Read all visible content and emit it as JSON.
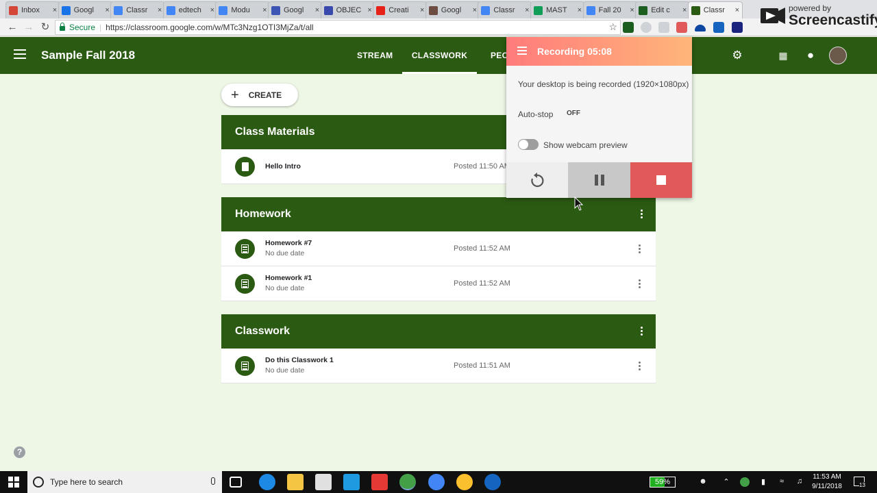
{
  "browser": {
    "tabs": [
      {
        "label": "Inbox",
        "color": "#d44638"
      },
      {
        "label": "Googl",
        "color": "#1a73e8"
      },
      {
        "label": "Classr",
        "color": "#4285f4"
      },
      {
        "label": "edtech",
        "color": "#4285f4"
      },
      {
        "label": "Modu",
        "color": "#4285f4"
      },
      {
        "label": "Googl",
        "color": "#3c55b4"
      },
      {
        "label": "OBJEC",
        "color": "#3949ab"
      },
      {
        "label": "Creati",
        "color": "#e62117"
      },
      {
        "label": "Googl",
        "color": "#6d4c41"
      },
      {
        "label": "Classr",
        "color": "#4285f4"
      },
      {
        "label": "MAST",
        "color": "#0f9d58"
      },
      {
        "label": "Fall 20",
        "color": "#4285f4"
      },
      {
        "label": "Edit c",
        "color": "#1b5e20"
      },
      {
        "label": "Classr",
        "color": "#2b5a12"
      }
    ],
    "secure_label": "Secure",
    "url": "https://classroom.google.com/w/MTc3Nzg1OTI3MjZa/t/all"
  },
  "header": {
    "class_title": "Sample Fall 2018",
    "nav": [
      "STREAM",
      "CLASSWORK",
      "PEO"
    ]
  },
  "create_label": "CREATE",
  "topics": [
    {
      "title": "Class Materials",
      "items": [
        {
          "title": "Hello Intro",
          "sub": "",
          "posted": "Posted 11:50 AM",
          "icon": "book-icon"
        }
      ]
    },
    {
      "title": "Homework",
      "items": [
        {
          "title": "Homework #7",
          "sub": "No due date",
          "posted": "Posted 11:52 AM",
          "icon": "assignment-icon"
        },
        {
          "title": "Homework #1",
          "sub": "No due date",
          "posted": "Posted 11:52 AM",
          "icon": "assignment-icon"
        }
      ]
    },
    {
      "title": "Classwork",
      "items": [
        {
          "title": "Do this Classwork 1",
          "sub": "No due date",
          "posted": "Posted 11:51 AM",
          "icon": "assignment-icon"
        }
      ]
    }
  ],
  "screencastify": {
    "title": "Recording 05:08",
    "desc": "Your desktop is being recorded (1920×1080px)",
    "autostop_label": "Auto-stop",
    "autostop_value": "OFF",
    "webcam_label": "Show webcam preview",
    "colors": {
      "restart": "#eeeeee",
      "pause": "#c8c8c8",
      "stop": "#e05a5a"
    }
  },
  "watermark": {
    "small": "powered by",
    "big": "Screencastify"
  },
  "taskbar": {
    "search_placeholder": "Type here to search",
    "battery": "59%",
    "time": "11:53 AM",
    "date": "9/11/2018",
    "notifications": "13"
  },
  "colors": {
    "brand_green": "#2b5a12",
    "page_bg": "#eef7e6"
  }
}
